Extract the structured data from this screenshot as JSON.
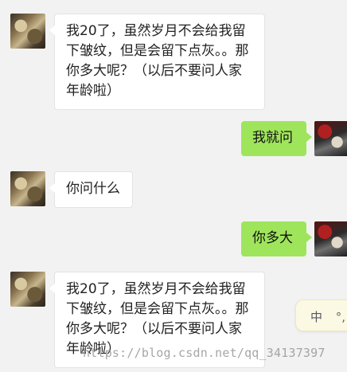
{
  "chat": {
    "messages": [
      {
        "side": "left",
        "text": "我20了，虽然岁月不会给我留下皱纹，但是会留下点灰。。那你多大呢？（以后不要问人家年龄啦）"
      },
      {
        "side": "right",
        "text": "我就问"
      },
      {
        "side": "left",
        "text": "你问什么"
      },
      {
        "side": "right",
        "text": "你多大"
      },
      {
        "side": "left",
        "text": "我20了，虽然岁月不会给我留下皱纹，但是会留下点灰。。那你多大呢？（以后不要问人家年龄啦）"
      }
    ]
  },
  "ime": {
    "mode": "中",
    "punct": "°,"
  },
  "watermark": "https://blog.csdn.net/qq_34137397",
  "colors": {
    "background": "#f2f2f2",
    "bubble_left": "#ffffff",
    "bubble_right": "#9fe55b"
  }
}
